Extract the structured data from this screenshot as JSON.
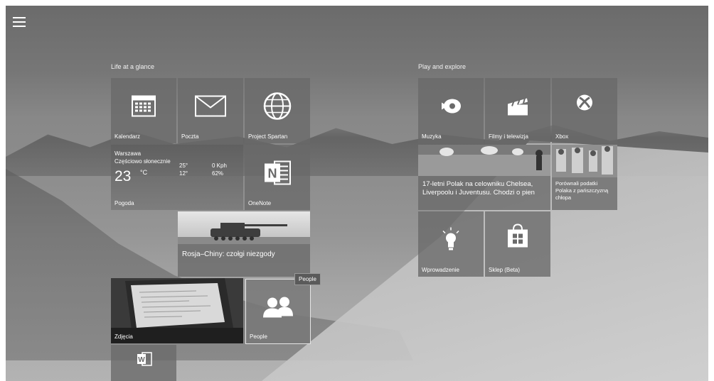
{
  "start_menu": {
    "groups": [
      {
        "title": "Life at a glance"
      },
      {
        "title": "Play and explore"
      }
    ],
    "tiles": {
      "calendar": {
        "label": "Kalendarz",
        "icon": "calendar-icon"
      },
      "mail": {
        "label": "Poczta",
        "icon": "mail-icon"
      },
      "spartan": {
        "label": "Project Spartan",
        "icon": "globe-icon"
      },
      "weather": {
        "label": "Pogoda",
        "city": "Warszawa",
        "condition": "Częściowo słonecznie",
        "temp": "23",
        "unit": "°C",
        "high": "25°",
        "low": "12°",
        "wind": "0 Kph",
        "humidity": "62%"
      },
      "onenote": {
        "label": "OneNote",
        "icon": "onenote-icon"
      },
      "news_tanks": {
        "headline": "Rosja–Chiny: czołgi niezgody"
      },
      "photos": {
        "label": "Zdjęcia"
      },
      "people": {
        "label": "People",
        "icon": "people-icon",
        "tooltip": "People"
      },
      "word": {
        "icon": "word-icon"
      },
      "music": {
        "label": "Muzyka",
        "icon": "music-disc-icon"
      },
      "movies": {
        "label": "Filmy i telewizja",
        "icon": "clapperboard-icon"
      },
      "xbox": {
        "label": "Xbox",
        "icon": "xbox-icon"
      },
      "sport_news": {
        "headline": "17-letni Polak na celowniku Chelsea, Liverpoolu i Juventusu. Chodzi o pien"
      },
      "money_news": {
        "headline": "Porównali podatki Polaka z pańszczyzną chłopa"
      },
      "getstarted": {
        "label": "Wprowadzenie",
        "icon": "lightbulb-icon"
      },
      "store": {
        "label": "Sklep (Beta)",
        "icon": "store-icon"
      }
    }
  },
  "colors": {
    "tile": "#696969",
    "text": "#ffffff"
  }
}
